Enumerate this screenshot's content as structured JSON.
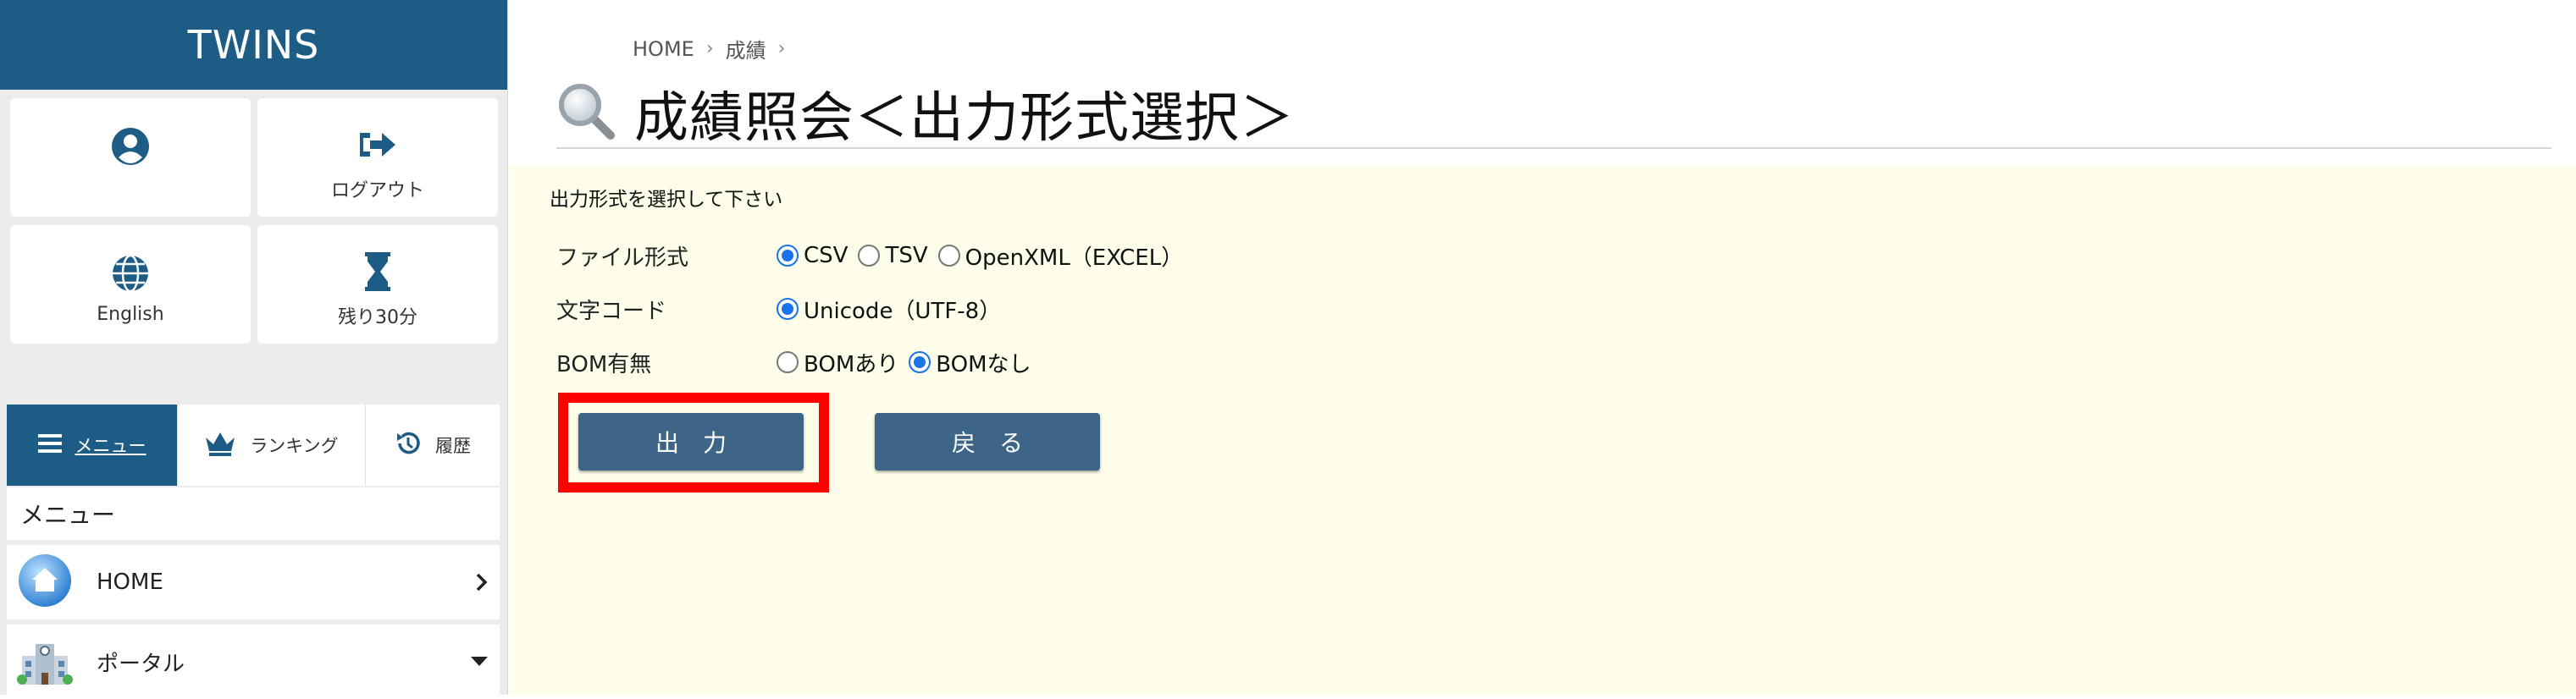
{
  "app": {
    "brand": "TWINS"
  },
  "sidebar": {
    "tiles": [
      {
        "icon": "user-circle-icon",
        "label": ""
      },
      {
        "icon": "logout-icon",
        "label": "ログアウト"
      },
      {
        "icon": "globe-icon",
        "label": "English"
      },
      {
        "icon": "hourglass-icon",
        "label": "残り30分"
      }
    ],
    "tabs": [
      {
        "icon": "hamburger-icon",
        "label": "メニュー",
        "active": true
      },
      {
        "icon": "crown-icon",
        "label": "ランキング",
        "active": false
      },
      {
        "icon": "history-icon",
        "label": "履歴",
        "active": false
      }
    ],
    "menu_heading": "メニュー",
    "menu_items": [
      {
        "icon": "home-icon",
        "label": "HOME",
        "indicator": "chevron-right-icon"
      },
      {
        "icon": "building-icon",
        "label": "ポータル",
        "indicator": "caret-down-icon"
      }
    ]
  },
  "breadcrumb": {
    "items": [
      "HOME",
      "成績"
    ],
    "separator": "›"
  },
  "page": {
    "title": "成績照会＜出力形式選択＞",
    "title_icon": "magnifier-icon"
  },
  "form": {
    "instruction": "出力形式を選択して下さい",
    "rows": [
      {
        "label": "ファイル形式",
        "options": [
          {
            "label": "CSV",
            "checked": true
          },
          {
            "label": "TSV",
            "checked": false
          },
          {
            "label": "OpenXML（EXCEL）",
            "checked": false
          }
        ]
      },
      {
        "label": "文字コード",
        "options": [
          {
            "label": "Unicode（UTF-8）",
            "checked": true
          }
        ]
      },
      {
        "label": "BOM有無",
        "options": [
          {
            "label": "BOMあり",
            "checked": false
          },
          {
            "label": "BOMなし",
            "checked": true
          }
        ]
      }
    ]
  },
  "buttons": {
    "output": "出力",
    "back": "戻る"
  },
  "colors": {
    "brand_blue": "#1d5c85",
    "button": "#3c6587",
    "panel_bg": "#fdfde9",
    "highlight": "#ff0000",
    "radio_selected": "#1a73e8"
  }
}
